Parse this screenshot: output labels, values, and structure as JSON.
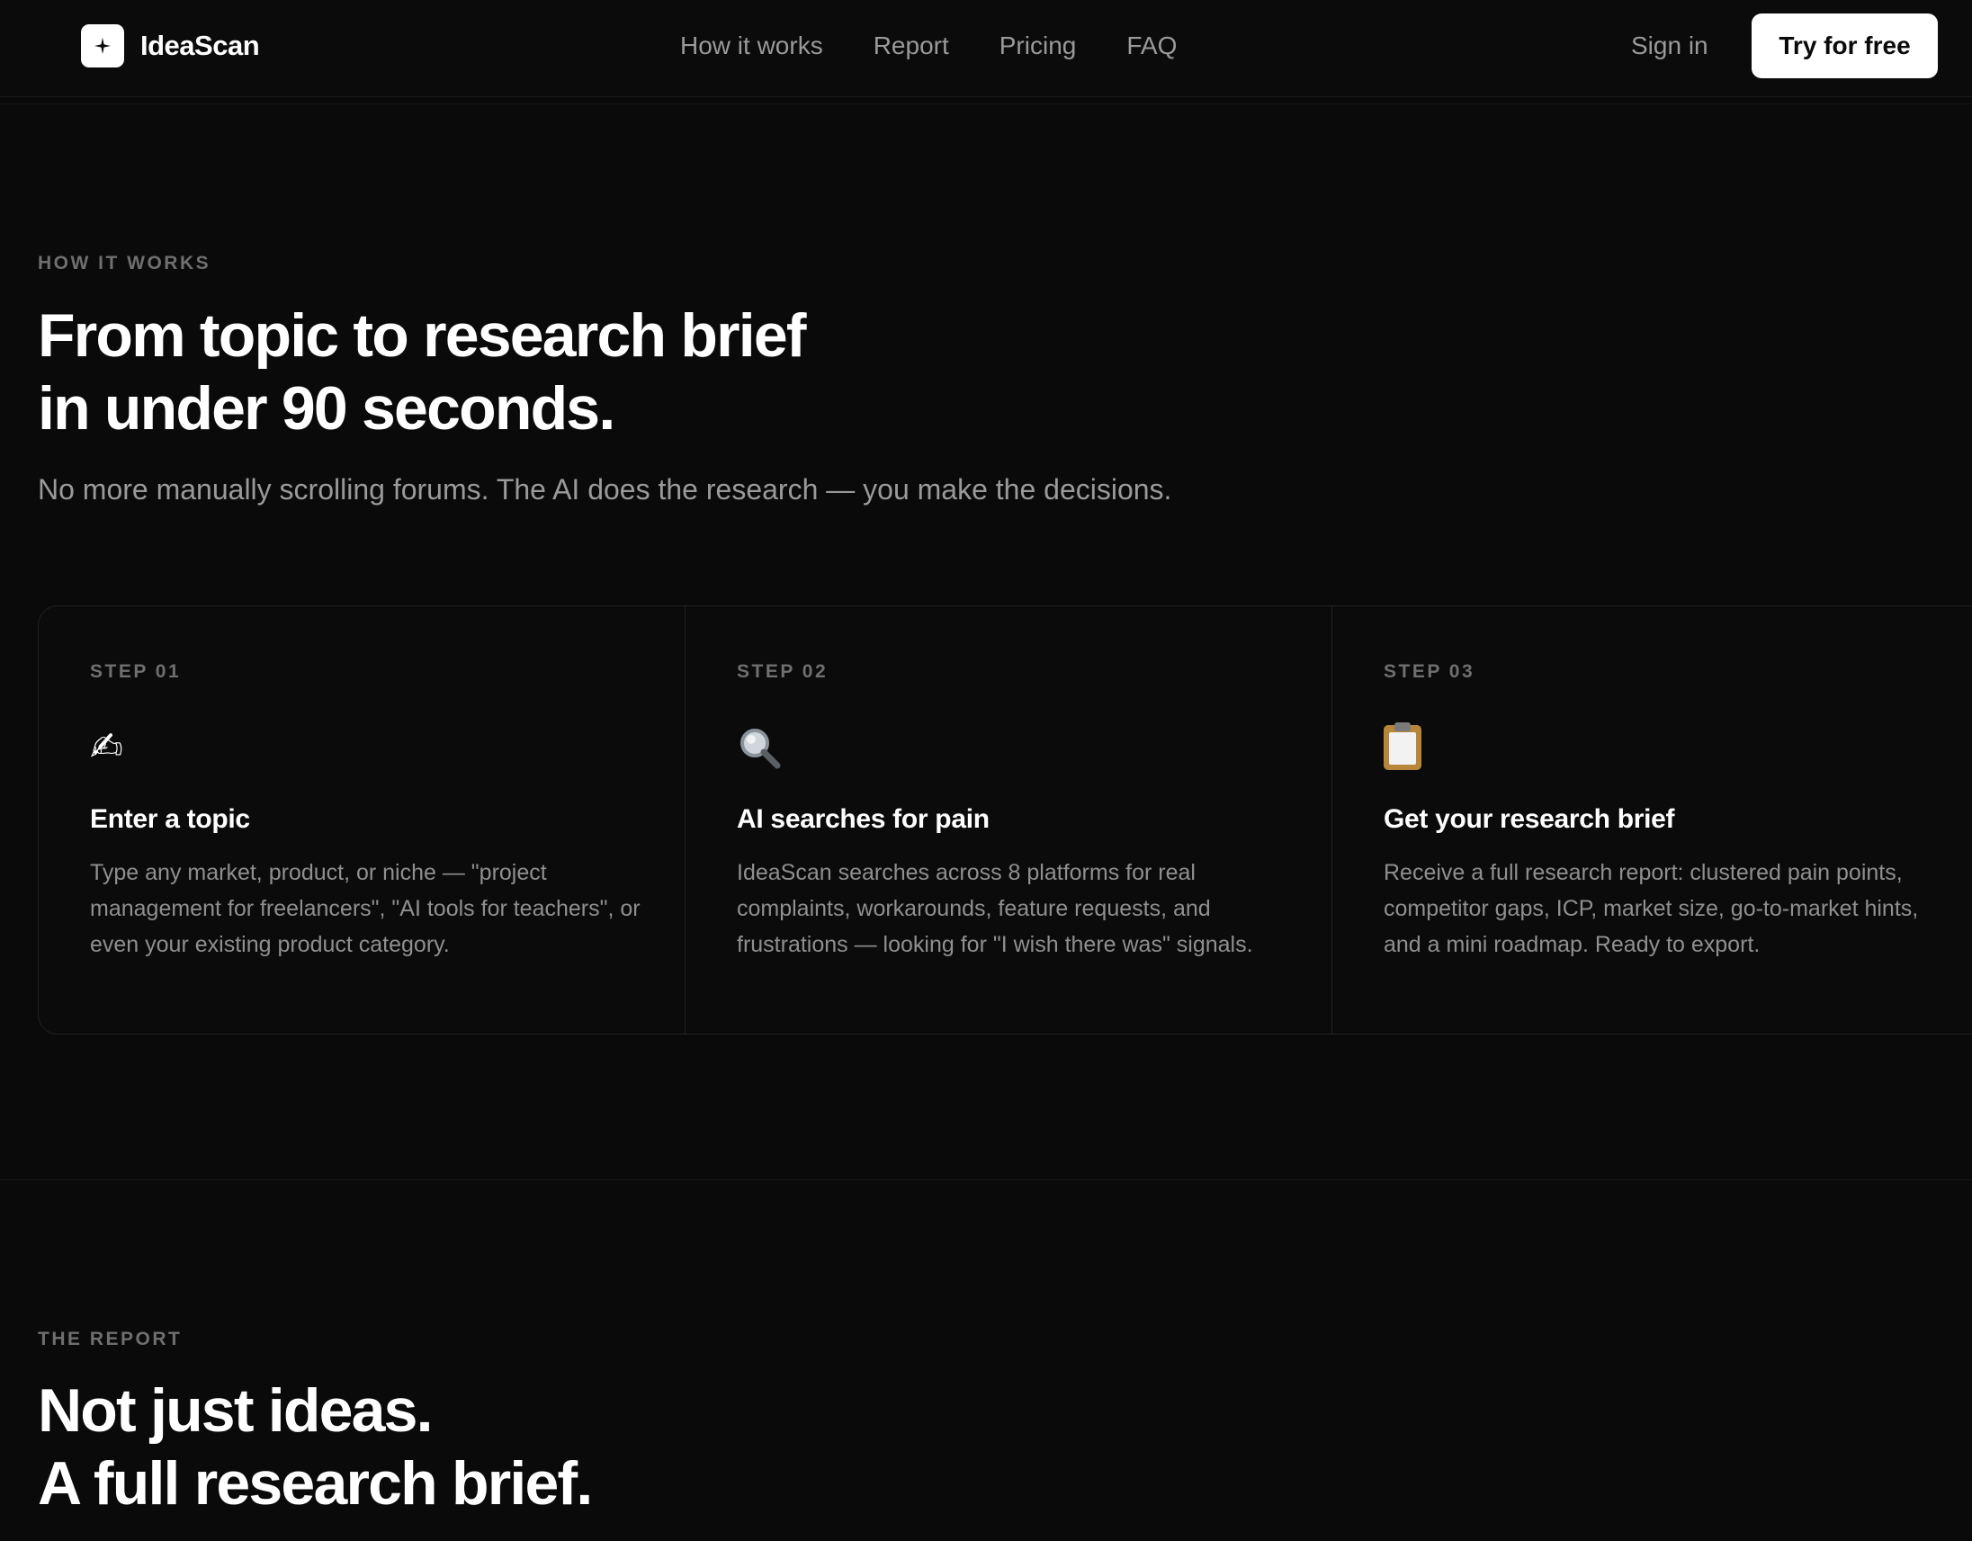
{
  "nav": {
    "brand": "IdeaScan",
    "links": [
      "How it works",
      "Report",
      "Pricing",
      "FAQ"
    ],
    "sign_in": "Sign in",
    "cta": "Try for free"
  },
  "how": {
    "eyebrow": "HOW IT WORKS",
    "title_line1": "From topic to research brief",
    "title_line2": "in under 90 seconds.",
    "subtitle": "No more manually scrolling forums. The AI does the research — you make the decisions.",
    "steps": [
      {
        "label": "STEP 01",
        "icon": "writing-hand-icon",
        "title": "Enter a topic",
        "description": "Type any market, product, or niche — \"project management for freelancers\", \"AI tools for teachers\", or even your existing product category."
      },
      {
        "label": "STEP 02",
        "icon": "magnifying-glass-icon",
        "title": "AI searches for pain",
        "description": "IdeaScan searches across 8 platforms for real complaints, workarounds, feature requests, and frustrations — looking for \"I wish there was\" signals."
      },
      {
        "label": "STEP 03",
        "icon": "clipboard-icon",
        "title": "Get your research brief",
        "description": "Receive a full research report: clustered pain points, competitor gaps, ICP, market size, go-to-market hints, and a mini roadmap. Ready to export."
      }
    ]
  },
  "report": {
    "eyebrow": "THE REPORT",
    "title_line1": "Not just ideas.",
    "title_line2": "A full research brief."
  }
}
